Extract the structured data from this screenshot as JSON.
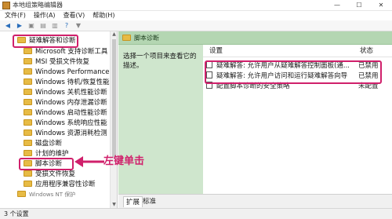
{
  "window": {
    "title": "本地组策略编辑器",
    "controls": {
      "minimize": "—",
      "maximize": "☐",
      "close": "✕"
    }
  },
  "menu": [
    "文件(F)",
    "操作(A)",
    "查看(V)",
    "帮助(H)"
  ],
  "toolbar_icons": [
    "back-arrow-icon",
    "forward-arrow-icon",
    "up-folder-icon",
    "show-hide-tree-icon",
    "export-list-icon",
    "help-icon",
    "filter-icon"
  ],
  "tree": {
    "parent": "疑难解答和诊断",
    "children": [
      "Microsoft 支持诊断工具",
      "MSI 受损文件恢复",
      "Windows Performance",
      "Windows 待机/恢复性能",
      "Windows 关机性能诊断",
      "Windows 内存泄漏诊断",
      "Windows 启动性能诊断",
      "Windows 系统响应性能",
      "Windows 资源消耗检测",
      "磁盘诊断",
      "计划的维护",
      "脚本诊断",
      "受损文件恢复",
      "应用程序兼容性诊断"
    ],
    "cutoff_item": "Windows NT 保护"
  },
  "right_pane": {
    "header": "脚本诊断",
    "description": "选择一个项目来查看它的描述。",
    "columns": {
      "setting": "设置",
      "state": "状态"
    },
    "rows": [
      {
        "setting": "疑难解答: 允许用户从疑难解答控制面板(通...",
        "state": "已禁用"
      },
      {
        "setting": "疑难解答: 允许用户访问和运行疑难解答向导",
        "state": "已禁用"
      },
      {
        "setting": "配置脚本诊断的安全策略",
        "state": "未配置"
      }
    ],
    "tabs": [
      "扩展",
      "标准"
    ]
  },
  "status_bar": "3 个设置",
  "annotation": "左键单击",
  "colors": {
    "highlight": "#d0206b",
    "header_green": "#b4d6b2",
    "desc_green": "#cfe6cd",
    "folder": "#e7bb45"
  }
}
